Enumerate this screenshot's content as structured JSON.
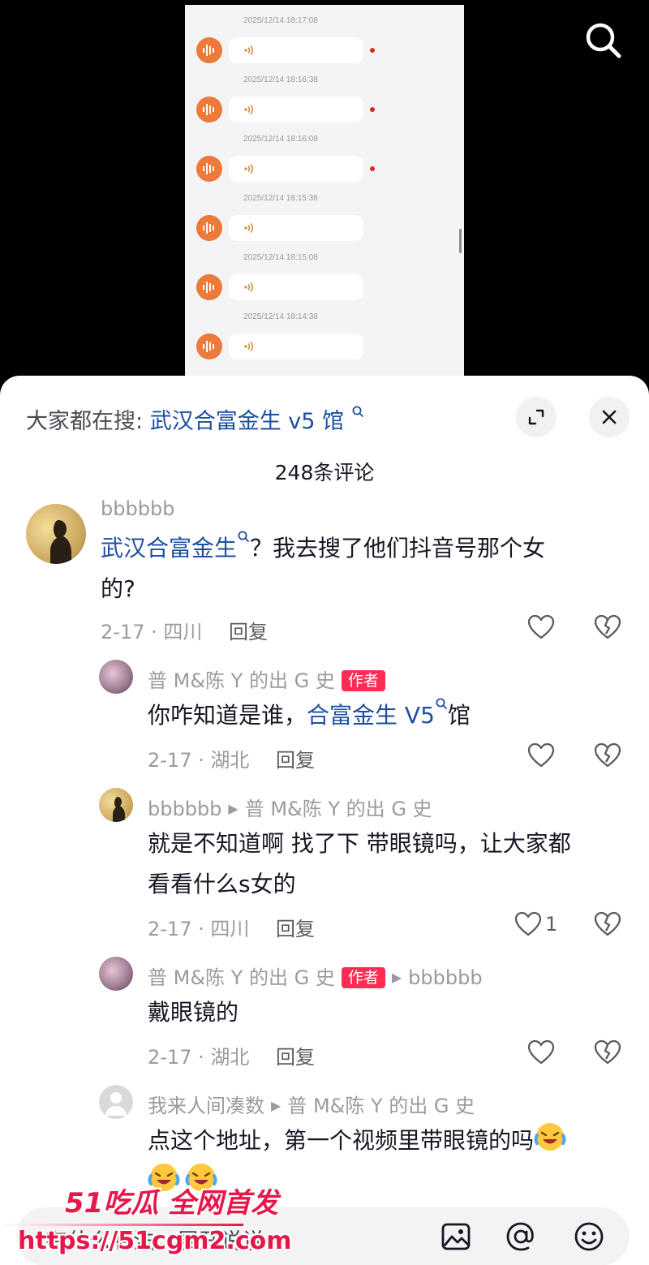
{
  "voice_messages": [
    {
      "time": "2025/12/14 18:17:08",
      "unread": true
    },
    {
      "time": "2025/12/14 18:16:38",
      "unread": true
    },
    {
      "time": "2025/12/14 18:16:08",
      "unread": true
    },
    {
      "time": "2025/12/14 18:15:38",
      "unread": false
    },
    {
      "time": "2025/12/14 18:15:08",
      "unread": false
    },
    {
      "time": "2025/12/14 18:14:38",
      "unread": false
    }
  ],
  "colors": {
    "accent": "#fe2c55",
    "keyword": "#1d4fa0",
    "voice_avatar": "#ec7a3a",
    "meta": "#9a9aa0"
  },
  "icons": {
    "top_search": "search-icon",
    "expand": "expand-icon",
    "close": "close-icon",
    "like": "heart-icon",
    "dislike": "broken-heart-icon",
    "image": "image-icon",
    "mention": "at-icon",
    "emoji": "emoji-icon"
  },
  "sheet": {
    "search_prefix": "大家都在搜:",
    "search_keyword": "武汉合富金生 v5 馆",
    "comment_count": "248条评论"
  },
  "comments": [
    {
      "user": "bbbbbb",
      "keyword": "武汉合富金生",
      "text_after": "？我去搜了他们抖音号那个女",
      "text_line2": "的?",
      "date_loc": "2-17 · 四川",
      "reply": "回复"
    },
    {
      "user": "普 M&陈 Y 的出 G 史",
      "badge": "作者",
      "text_before": "你咋知道是谁，",
      "keyword": "合富金生 V5",
      "text_after": "馆",
      "date_loc": "2-17 · 湖北",
      "reply": "回复"
    },
    {
      "user": "bbbbbb",
      "reply_to": "普 M&陈 Y 的出 G 史",
      "text_line1": "就是不知道啊 找了下 带眼镜吗，让大家都",
      "text_line2": "看看什么s女的",
      "date_loc": "2-17 · 四川",
      "reply": "回复",
      "likes": "1"
    },
    {
      "user": "普 M&陈 Y 的出 G 史",
      "badge": "作者",
      "reply_to": "bbbbbb",
      "text": "戴眼镜的",
      "date_loc": "2-17 · 湖北",
      "reply": "回复"
    },
    {
      "user": "我来人间凑数",
      "reply_to": "普 M&陈 Y 的出 G 史",
      "text": "点这个地址，第一个视频里带眼镜的吗"
    }
  ],
  "input": {
    "placeholder": "有什么想法，展开说说"
  },
  "watermark": {
    "brand": "51吃瓜 全网首发",
    "url": "https://51cgm2.com"
  }
}
